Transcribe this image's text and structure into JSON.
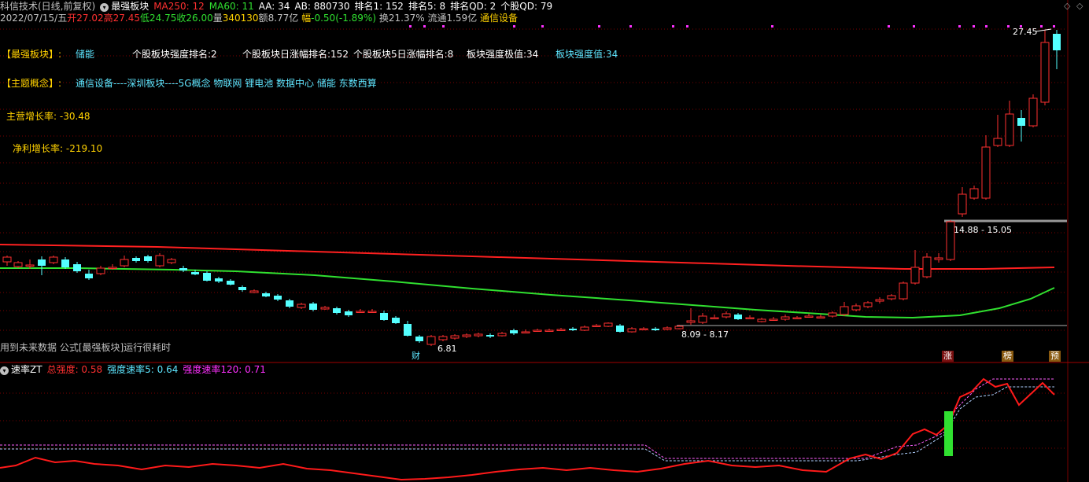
{
  "header": {
    "stock": "科信技术(日线,前复权)",
    "indicator": "最强板块",
    "ma250": "MA250: 12",
    "ma60": "MA60: 11",
    "aa": "AA: 34",
    "ab": "AB: 880730",
    "rank1": "排名1: 152",
    "rank5": "排名5: 8",
    "rankqd": "排名QD: 2",
    "stockqd": "个股QD: 79"
  },
  "quote": {
    "date": "2022/07/15/五",
    "open_label": "开",
    "open": "27.02",
    "high_label": "高",
    "high": "27.45",
    "low_label": "低",
    "low": "24.75",
    "close_label": "收",
    "close": "26.00",
    "vol_label": "量",
    "vol": "340130",
    "amt_label": "额",
    "amt": "8.77亿",
    "chg_label": "幅",
    "chg": "-0.50(-1.89%)",
    "turn_label": "换",
    "turn": "21.37%",
    "float_label": "流通",
    "float": "1.59亿",
    "industry": "通信设备"
  },
  "info": {
    "sector_label": "【最强板块】:",
    "sector_name": "储能",
    "rank_strength": "个股板块强度排名:2",
    "rank_day": "个股板块日涨幅排名:152",
    "rank_5day": "个股板块5日涨幅排名:8",
    "strength_max": "板块强度极值:34",
    "strength_val": "板块强度值:34",
    "concept_label": "【主题概念】:",
    "concepts": "通信设备----深圳板块----5G概念 物联网 锂电池 数据中心 储能 东数西算",
    "revenue_growth": "主营增长率: -30.48",
    "profit_growth": "净利增长率: -219.10"
  },
  "price_labels": {
    "high": "27.45",
    "range1": "14.88 - 15.05",
    "range2": "8.09 - 8.17",
    "low": "6.81"
  },
  "warning": "用到未来数据 公式[最强板块]运行很耗时",
  "markers": {
    "cai": "财",
    "zhang": "涨",
    "bang": "榜",
    "yu": "预"
  },
  "sub": {
    "title": "速率ZT",
    "total": "总强度: 0.58",
    "speed5": "强度速率5: 0.64",
    "speed120": "强度速率120: 0.71"
  },
  "colors": {
    "up": "#ff3030",
    "down": "#54ffff",
    "ma250": "#ff2020",
    "ma60": "#30e030",
    "grid": "#7a0000",
    "magenta": "#ff30ff",
    "yellow": "#ffd200",
    "cyan": "#5ee6ff"
  },
  "icons": {
    "dropdown": "chevron-down-icon",
    "nav_left": "diamond-left-icon",
    "nav_right": "diamond-right-icon"
  }
}
